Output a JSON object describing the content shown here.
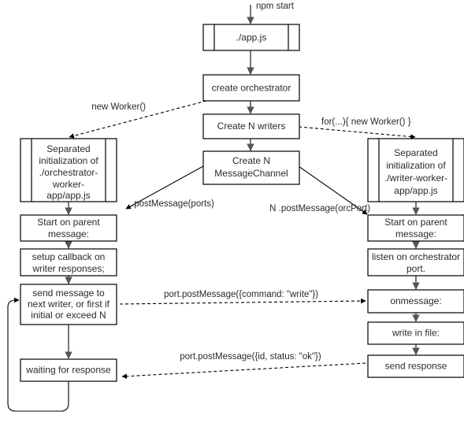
{
  "diagram": {
    "title": "npm start worker orchestration flow",
    "colors": {
      "background": "#ffffff",
      "node_stroke": "#000000",
      "node_fill": "#ffffff",
      "text": "#2a2a2a",
      "solid_edge": "#555555",
      "dashed_edge": "#000000"
    },
    "entry_label": "npm start",
    "nodes": [
      {
        "id": "app_js",
        "label": "./app.js",
        "shape": "predefined-process"
      },
      {
        "id": "create_orchestrator",
        "label": "create orchestrator",
        "shape": "process"
      },
      {
        "id": "create_n_writers",
        "label": "Create N writers",
        "shape": "process"
      },
      {
        "id": "create_n_messagechannel",
        "label": "Create N\nMessageChannel",
        "shape": "process",
        "lines": [
          "Create N",
          "MessageChannel"
        ]
      },
      {
        "id": "orchestrator_worker",
        "label": "Separated initialization of ./orchestrator-worker-app/app.js",
        "shape": "predefined-process",
        "lines": [
          "Separated",
          "initialization of",
          "./orchestrator-",
          "worker-",
          "app/app.js"
        ]
      },
      {
        "id": "writer_worker",
        "label": "Separated initialization of ./writer-worker-app/app.js",
        "shape": "predefined-process",
        "lines": [
          "Separated",
          "initialization of",
          "./writer-worker-",
          "app/app.js"
        ]
      },
      {
        "id": "orc_start_on_parent",
        "label": "Start on parent message:",
        "shape": "process",
        "lines": [
          "Start on parent",
          "message:"
        ]
      },
      {
        "id": "setup_callback",
        "label": "setup callback on writer responses;",
        "shape": "process",
        "lines": [
          "setup callback on",
          "writer responses;"
        ]
      },
      {
        "id": "send_message",
        "label": "send message to next writer, or first if initial or exceed N",
        "shape": "process",
        "lines": [
          "send message to",
          "next writer, or first if",
          "initial or exceed N"
        ]
      },
      {
        "id": "waiting_for_response",
        "label": "waiting for response",
        "shape": "process"
      },
      {
        "id": "wr_start_on_parent",
        "label": "Start on parent message:",
        "shape": "process",
        "lines": [
          "Start on parent",
          "message:"
        ]
      },
      {
        "id": "listen_on_port",
        "label": "listen on orchestrator port.",
        "shape": "process",
        "lines": [
          "listen on orchestrator",
          "port."
        ]
      },
      {
        "id": "onmessage",
        "label": "onmessage:",
        "shape": "process"
      },
      {
        "id": "write_in_file",
        "label": "write in file:",
        "shape": "process"
      },
      {
        "id": "send_response",
        "label": "send response",
        "shape": "process"
      }
    ],
    "edges": [
      {
        "id": "e_entry",
        "from": "npm start",
        "to": "app_js",
        "label": "npm start",
        "style": "solid"
      },
      {
        "id": "e_app_orch",
        "from": "app_js",
        "to": "create_orchestrator",
        "label": "",
        "style": "solid"
      },
      {
        "id": "e_orch_writers",
        "from": "create_orchestrator",
        "to": "create_n_writers",
        "label": "",
        "style": "solid"
      },
      {
        "id": "e_writers_channel",
        "from": "create_n_writers",
        "to": "create_n_messagechannel",
        "label": "",
        "style": "solid"
      },
      {
        "id": "e_new_worker",
        "from": "create_orchestrator",
        "to": "orchestrator_worker",
        "label": "new Worker()",
        "style": "dashed"
      },
      {
        "id": "e_for_new_worker",
        "from": "create_n_writers",
        "to": "writer_worker",
        "label": "for(...){ new Worker() }",
        "style": "dashed"
      },
      {
        "id": "e_postmessage_ports",
        "from": "create_n_messagechannel",
        "to": "orc_start_on_parent",
        "label": ".postMessage(ports)",
        "style": "thin"
      },
      {
        "id": "e_postmessage_orcport",
        "from": "create_n_messagechannel",
        "to": "wr_start_on_parent",
        "label": "N .postMessage(orcPort)",
        "style": "thin"
      },
      {
        "id": "e_orcworker_start",
        "from": "orchestrator_worker",
        "to": "orc_start_on_parent",
        "label": "",
        "style": "solid"
      },
      {
        "id": "e_start_setup",
        "from": "orc_start_on_parent",
        "to": "setup_callback",
        "label": "",
        "style": "solid"
      },
      {
        "id": "e_setup_send",
        "from": "setup_callback",
        "to": "send_message",
        "label": "",
        "style": "solid"
      },
      {
        "id": "e_send_waiting",
        "from": "send_message",
        "to": "waiting_for_response",
        "label": "",
        "style": "solid"
      },
      {
        "id": "e_loop_back",
        "from": "waiting_for_response",
        "to": "send_message",
        "label": "",
        "style": "thin"
      },
      {
        "id": "e_wrworker_start",
        "from": "writer_worker",
        "to": "wr_start_on_parent",
        "label": "",
        "style": "solid"
      },
      {
        "id": "e_wrstart_listen",
        "from": "wr_start_on_parent",
        "to": "listen_on_port",
        "label": "",
        "style": "solid"
      },
      {
        "id": "e_listen_onmessage",
        "from": "listen_on_port",
        "to": "onmessage",
        "label": "",
        "style": "solid"
      },
      {
        "id": "e_onmessage_write",
        "from": "onmessage",
        "to": "write_in_file",
        "label": "",
        "style": "solid"
      },
      {
        "id": "e_write_send",
        "from": "write_in_file",
        "to": "send_response",
        "label": "",
        "style": "solid"
      },
      {
        "id": "e_write_command",
        "from": "send_message",
        "to": "onmessage",
        "label": "port.postMessage({command: \"write\"})",
        "style": "dashed"
      },
      {
        "id": "e_status_ok",
        "from": "send_response",
        "to": "waiting_for_response",
        "label": "port.postMessage({id, status: \"ok\"})",
        "style": "dashed"
      }
    ],
    "labels": {
      "npm_start": "npm start",
      "new_worker": "new Worker()",
      "for_new_worker": "for(...){ new Worker() }",
      "postmessage_ports": ".postMessage(ports)",
      "postmessage_orcport": "N .postMessage(orcPort)",
      "write_command": "port.postMessage({command: \"write\"})",
      "status_ok": "port.postMessage({id, status: \"ok\"})"
    },
    "node_text": {
      "app_js": "./app.js",
      "create_orchestrator": "create orchestrator",
      "create_n_writers": "Create N writers",
      "create_n_messagechannel_l1": "Create N",
      "create_n_messagechannel_l2": "MessageChannel",
      "orchestrator_worker_l1": "Separated",
      "orchestrator_worker_l2": "initialization of",
      "orchestrator_worker_l3": "./orchestrator-",
      "orchestrator_worker_l4": "worker-",
      "orchestrator_worker_l5": "app/app.js",
      "writer_worker_l1": "Separated",
      "writer_worker_l2": "initialization of",
      "writer_worker_l3": "./writer-worker-",
      "writer_worker_l4": "app/app.js",
      "orc_start_l1": "Start on parent",
      "orc_start_l2": "message:",
      "setup_callback_l1": "setup callback on",
      "setup_callback_l2": "writer responses;",
      "send_message_l1": "send message to",
      "send_message_l2": "next writer, or first if",
      "send_message_l3": "initial or exceed N",
      "waiting_for_response": "waiting for response",
      "wr_start_l1": "Start on parent",
      "wr_start_l2": "message:",
      "listen_on_port_l1": "listen on orchestrator",
      "listen_on_port_l2": "port.",
      "onmessage": "onmessage:",
      "write_in_file": "write in file:",
      "send_response": "send response"
    }
  }
}
